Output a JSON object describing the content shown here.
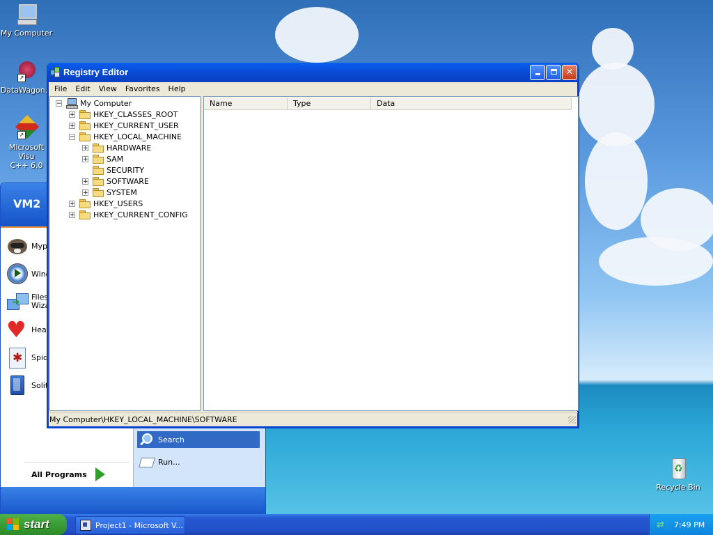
{
  "desktop": {
    "icons": [
      {
        "label": "My Computer"
      },
      {
        "label": "DataWagon..."
      },
      {
        "label": "Microsoft Visual C++ 6.0",
        "line1": "Microsoft Visu",
        "line2": "C++ 6.0"
      },
      {
        "label": "Recycle Bin"
      }
    ]
  },
  "start_menu": {
    "user_name": "VM2",
    "left_items": [
      {
        "label": "Myp",
        "icon": "raccoon-icon"
      },
      {
        "label": "Wind",
        "icon": "media-player-icon"
      },
      {
        "label_line1": "Files",
        "label_line2": "Wiza",
        "icon": "files-wizard-icon"
      },
      {
        "label": "Hear",
        "icon": "heart-icon"
      },
      {
        "label": "Spid",
        "icon": "spider-icon"
      },
      {
        "label": "Solit",
        "icon": "solitaire-icon"
      }
    ],
    "all_programs": "All Programs",
    "right_items": [
      {
        "label": "Search",
        "icon": "search-icon",
        "highlighted": true
      },
      {
        "label": "Run...",
        "icon": "run-icon"
      }
    ]
  },
  "window": {
    "title": "Registry Editor",
    "menus": [
      "File",
      "Edit",
      "View",
      "Favorites",
      "Help"
    ],
    "tree": [
      {
        "label": "My Computer",
        "expander": "−"
      },
      {
        "label": "HKEY_CLASSES_ROOT",
        "expander": "+"
      },
      {
        "label": "HKEY_CURRENT_USER",
        "expander": "+"
      },
      {
        "label": "HKEY_LOCAL_MACHINE",
        "expander": "−"
      },
      {
        "label": "HARDWARE",
        "expander": "+"
      },
      {
        "label": "SAM",
        "expander": "+"
      },
      {
        "label": "SECURITY",
        "expander": ""
      },
      {
        "label": "SOFTWARE",
        "expander": "+"
      },
      {
        "label": "SYSTEM",
        "expander": "+"
      },
      {
        "label": "HKEY_USERS",
        "expander": "+"
      },
      {
        "label": "HKEY_CURRENT_CONFIG",
        "expander": "+"
      }
    ],
    "columns": [
      "Name",
      "Type",
      "Data"
    ],
    "status": "My Computer\\HKEY_LOCAL_MACHINE\\SOFTWARE"
  },
  "taskbar": {
    "start_label": "start",
    "task_label": "Project1 - Microsoft V...",
    "clock": "7:49 PM"
  },
  "colors": {
    "titlebar": "#0a5ef0",
    "start_button": "#389c33",
    "taskbar": "#2250c9",
    "highlight": "#316ac5"
  }
}
